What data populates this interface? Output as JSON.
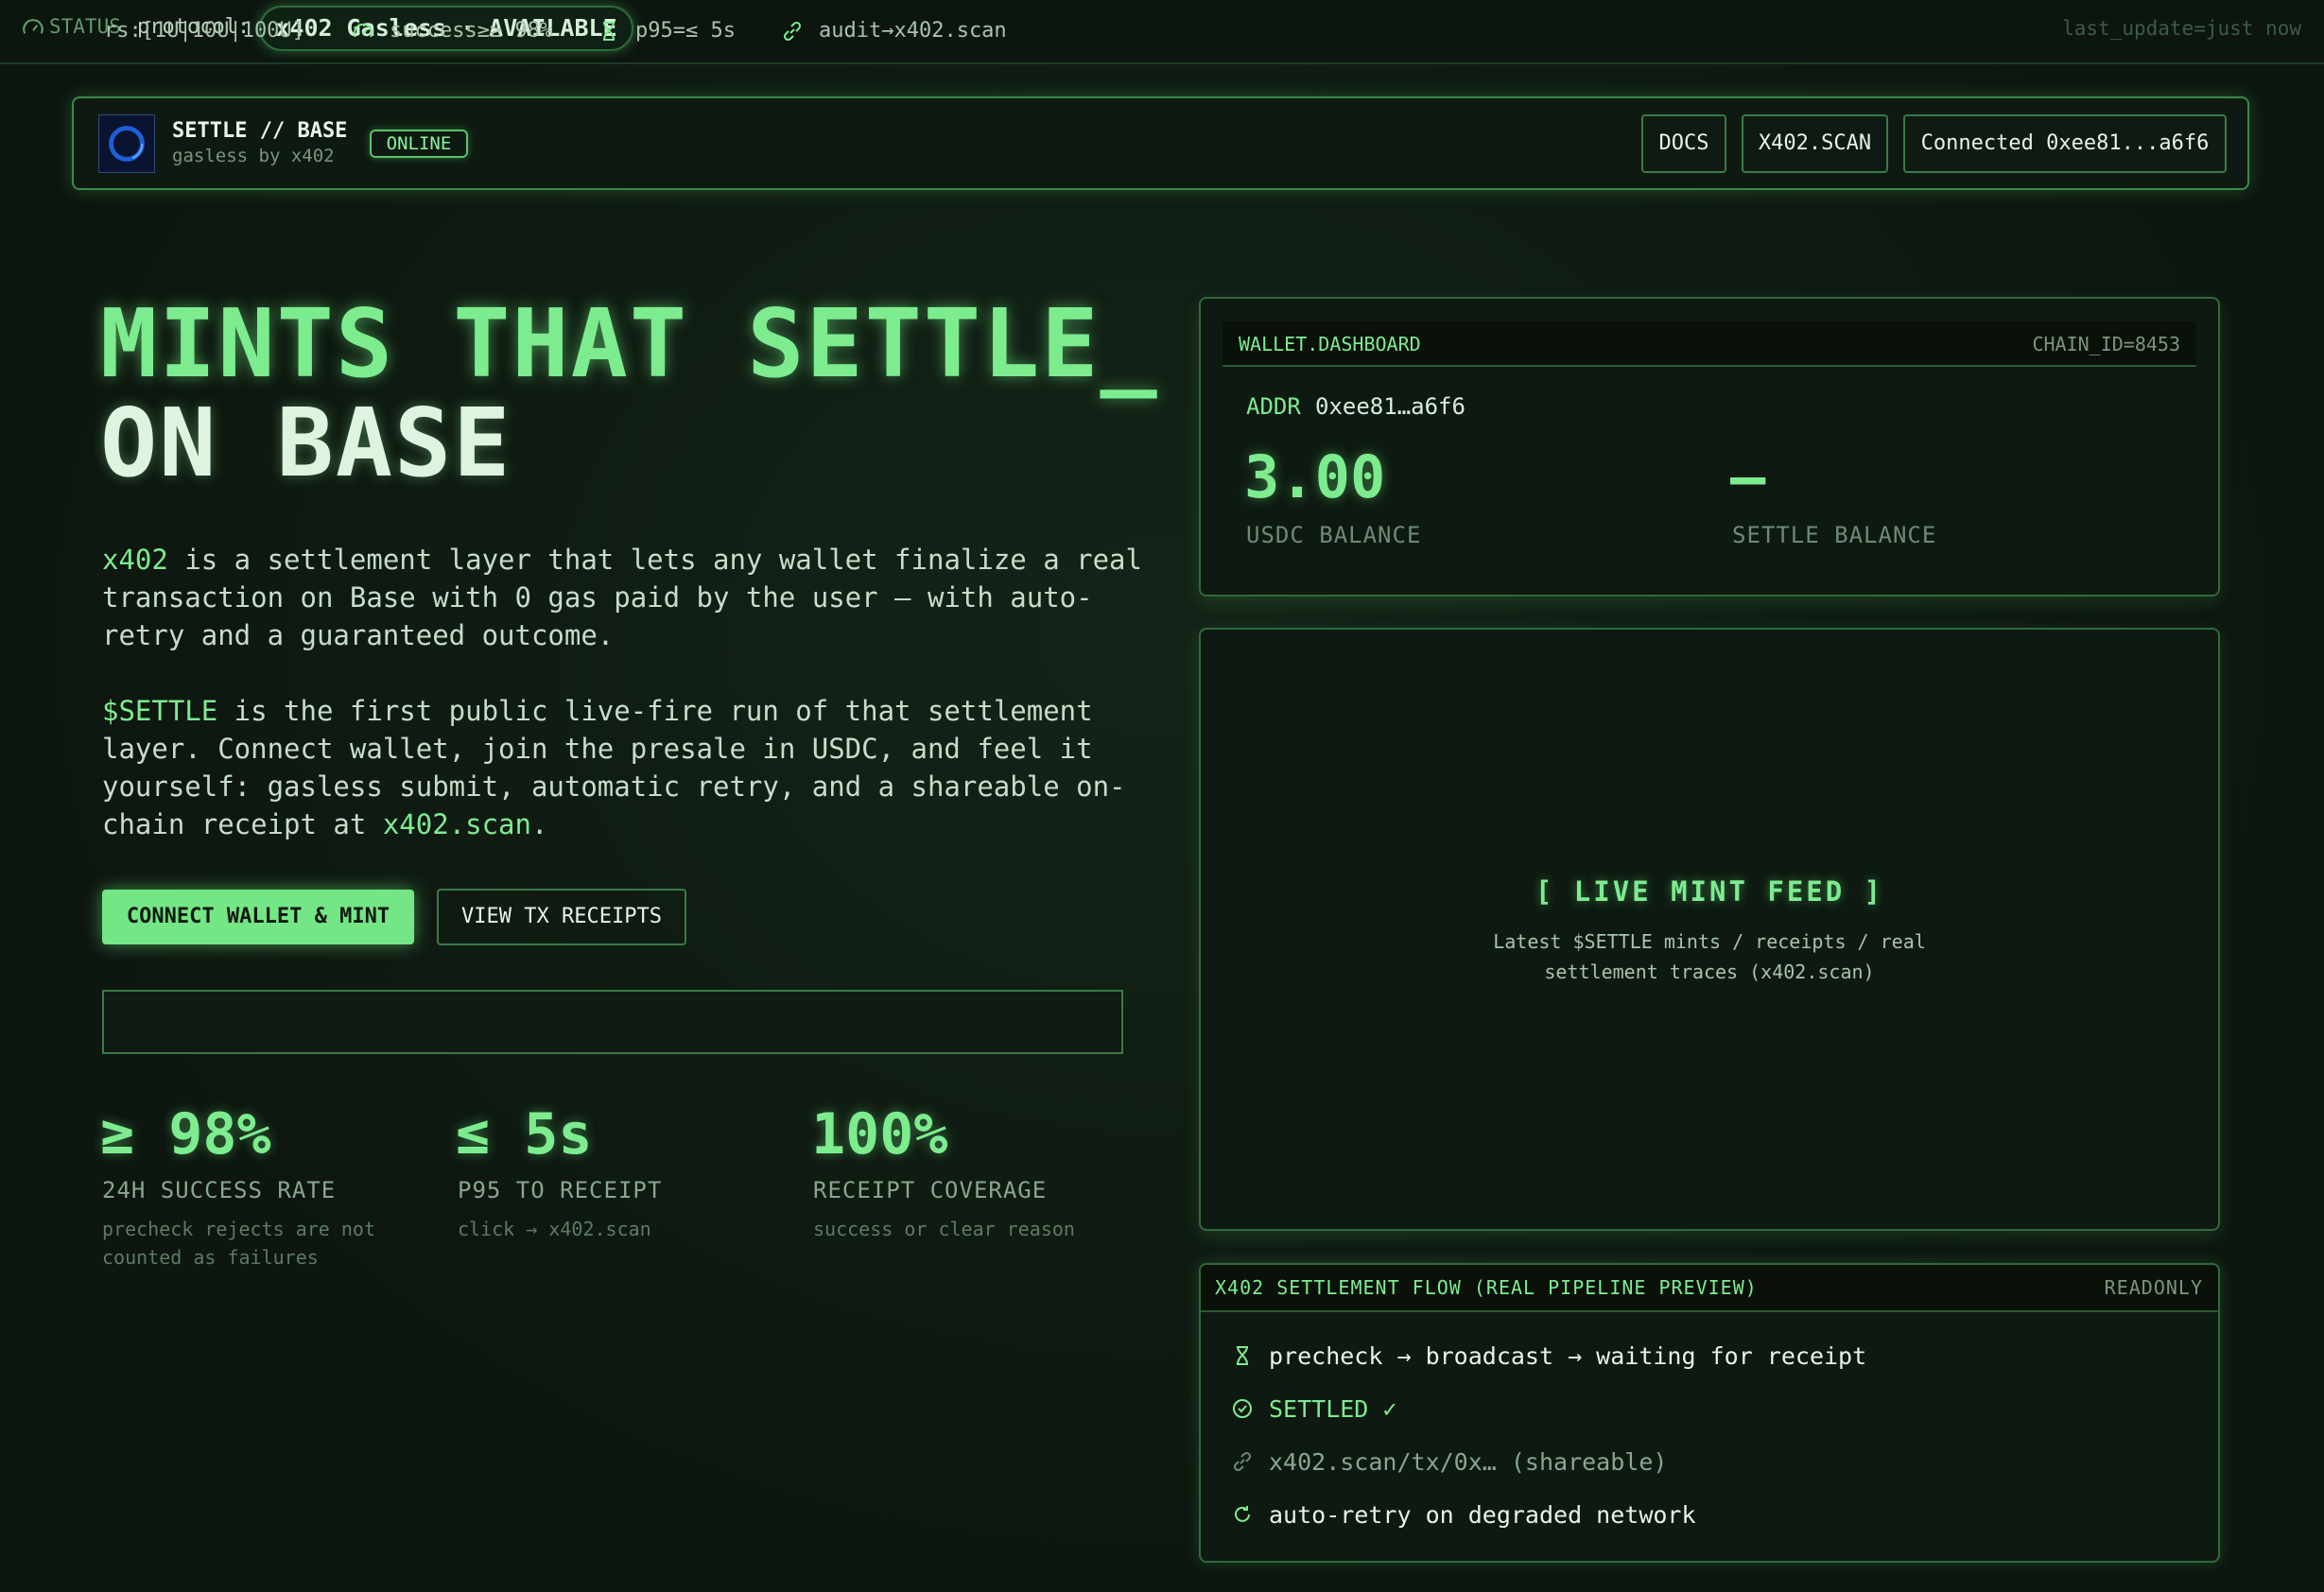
{
  "status_bar": {
    "status_label": "STATUS",
    "protocol_label": "protocol:",
    "protocol_value": "x402 Gasless · AVAILABLE",
    "last_update": "last_update=just now"
  },
  "header": {
    "brand_title": "SETTLE // BASE",
    "brand_sub": "gasless by x402",
    "online_badge": "ONLINE",
    "docs": "DOCS",
    "scan": "X402.SCAN",
    "connected": "Connected 0xee81...a6f6"
  },
  "hero": {
    "line1": "MINTS THAT SETTLE_",
    "line2": "ON BASE",
    "para1": {
      "highlight": "x402",
      "text": " is a settlement layer that lets any wallet finalize a real transaction on Base with 0 gas paid by the user — with auto-retry and a guaranteed outcome."
    },
    "para2": {
      "highlight": "$SETTLE",
      "text": " is the first public live-fire run of that settlement layer. Connect wallet, join the presale in USDC, and feel it yourself: gasless submit, automatic retry, and a shareable on-chain receipt at ",
      "link": "x402.scan",
      "end": "."
    },
    "cta_primary": "CONNECT WALLET & MINT",
    "cta_secondary": "VIEW TX RECEIPTS"
  },
  "ticker": {
    "tiers": "rs:[1U|10U|100U]",
    "success": "success≥≥ 98%",
    "p95": "p95=≤ 5s",
    "audit": "audit→x402.scan"
  },
  "stats": [
    {
      "value": "≥ 98%",
      "label": "24H SUCCESS RATE",
      "desc": "precheck rejects are not counted as failures"
    },
    {
      "value": "≤ 5s",
      "label": "P95 TO RECEIPT",
      "desc": "click → x402.scan"
    },
    {
      "value": "100%",
      "label": "RECEIPT COVERAGE",
      "desc": "success or clear reason"
    }
  ],
  "wallet": {
    "title": "WALLET.DASHBOARD",
    "chain_id": "CHAIN_ID=8453",
    "addr_label": "ADDR",
    "addr_value": "0xee81…a6f6",
    "usdc_value": "3.00",
    "usdc_label": "USDC BALANCE",
    "settle_value": "–",
    "settle_label": "SETTLE BALANCE"
  },
  "feed": {
    "title": "[ LIVE MINT FEED ]",
    "desc": "Latest $SETTLE mints / receipts / real settlement traces (x402.scan)"
  },
  "flow": {
    "title": "X402 SETTLEMENT FLOW (REAL PIPELINE PREVIEW)",
    "readonly": "READONLY",
    "steps": [
      {
        "icon": "hourglass-icon",
        "text": "precheck → broadcast → waiting for receipt"
      },
      {
        "icon": "check-circle-icon",
        "text": "SETTLED ✓"
      },
      {
        "icon": "link-icon",
        "text": "x402.scan/tx/0x… (shareable)"
      },
      {
        "icon": "refresh-icon",
        "text": "auto-retry on degraded network"
      }
    ]
  },
  "colors": {
    "accent": "#7dec8f",
    "background": "#0f1a12",
    "border": "#3a7a46"
  }
}
